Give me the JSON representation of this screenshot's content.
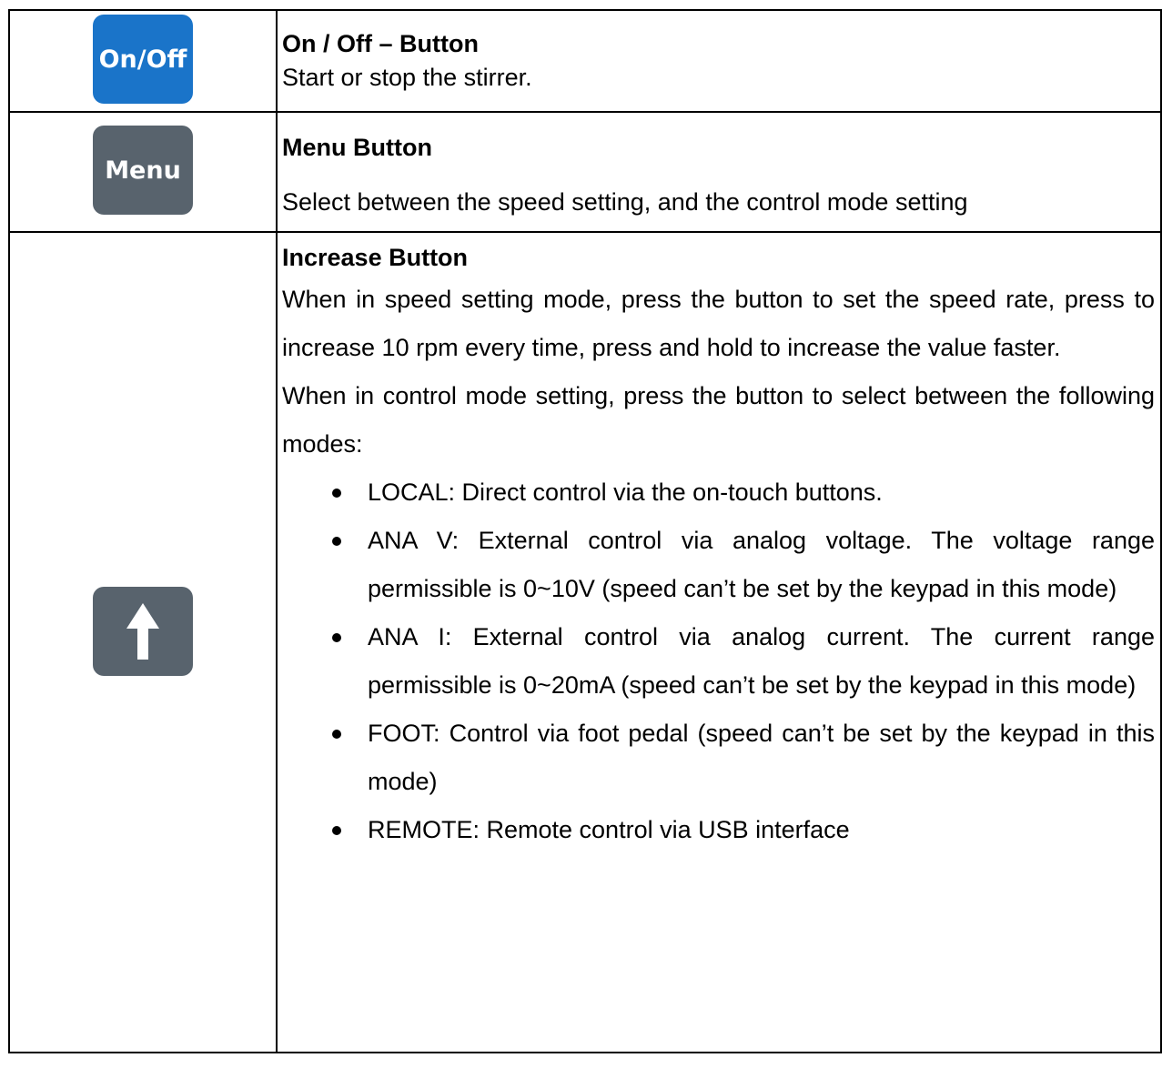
{
  "rows": [
    {
      "key_label": "On/Off",
      "key_color": "#1a74c9",
      "title": "On / Off – Button",
      "description": "Start or stop the stirrer."
    },
    {
      "key_label": "Menu",
      "key_color": "#58636d",
      "title": "Menu Button",
      "description": "Select between the speed setting, and the control mode setting"
    },
    {
      "key_icon": "up-arrow-icon",
      "key_color": "#58636d",
      "title": "Increase Button",
      "paragraph_1": "When in speed setting mode, press the button to set the speed rate, press to increase 10 rpm every time, press and hold to increase the value faster.",
      "paragraph_2": "When in control mode setting, press the button to select between the following modes:",
      "modes": [
        "LOCAL: Direct control via the on-touch buttons.",
        "ANA V: External control via analog voltage. The voltage range permissible is 0~10V (speed can’t be set by the keypad in this mode)",
        "ANA I: External control via analog current. The current range permissible is 0~20mA (speed can’t be set by the keypad in this mode)",
        "FOOT: Control via foot pedal (speed can’t be set by the keypad in this mode)",
        "REMOTE: Remote control via USB interface"
      ]
    }
  ]
}
